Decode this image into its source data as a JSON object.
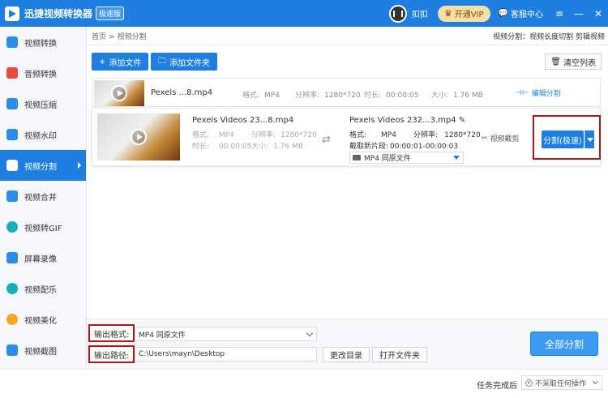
{
  "titlebar": {
    "title": "迅捷视频转换器",
    "edition": "极速版",
    "logout": "扣扣",
    "vip": "开通VIP",
    "service": "客服中心",
    "ctl_menu": "≡",
    "ctl_min": "—",
    "ctl_close": "✕"
  },
  "sidebar": {
    "items": [
      {
        "label": "视频转换"
      },
      {
        "label": "音频转换"
      },
      {
        "label": "视频压缩"
      },
      {
        "label": "视频水印"
      },
      {
        "label": "视频分割"
      },
      {
        "label": "视频合并"
      },
      {
        "label": "视频转GIF"
      },
      {
        "label": "屏幕录像"
      },
      {
        "label": "视频配乐"
      },
      {
        "label": "视频美化"
      },
      {
        "label": "视频截图"
      }
    ],
    "active_index": 4
  },
  "breadcrumb": {
    "home": "首页",
    "sep": ">",
    "current": "视频分割"
  },
  "top_hint": "视频分割：视频长度切割 剪辑视频",
  "toolbar": {
    "add_file": "添加文件",
    "add_folder": "添加文件夹",
    "clear_list": "清空列表"
  },
  "row1": {
    "name": "Pexels ...8.mp4",
    "format_label": "格式:",
    "format": "MP4",
    "resolution_label": "分辨率:",
    "resolution": "1280*720",
    "duration_label": "时长:",
    "duration": "00:00:05",
    "size_label": "大小:",
    "size": "1.76 MB",
    "edit_split": "编辑分割"
  },
  "row2": {
    "name": "Pexels Videos 23...8.mp4",
    "format_label": "格式:",
    "format": "MP4",
    "resolution_label": "分辨率:",
    "resolution": "1280*720",
    "duration_label": "时长:",
    "duration": "00:00:05",
    "size_label": "大小:",
    "size": "1.76 MB",
    "out_name": "Pexels Videos 232...3.mp4",
    "out_format_label": "格式:",
    "out_format": "MP4",
    "out_resolution_label": "分辨率:",
    "out_resolution": "1280*720",
    "clip_label": "截取新片段:",
    "clip": "00:00:01-00:00:03",
    "out_select": "MP4  同原文件",
    "screenshot": "视频截剪",
    "split_btn": "分割(极速)"
  },
  "bottom": {
    "format_label": "输出格式:",
    "format_value": "MP4  同原文件",
    "path_label": "输出路径:",
    "path_value": "C:\\Users\\mayn\\Desktop",
    "change_dir": "更改目录",
    "open_folder": "打开文件夹",
    "all_split": "全部分割"
  },
  "status": {
    "after_done": "任务完成后",
    "after_value": "不采取任何操作"
  }
}
